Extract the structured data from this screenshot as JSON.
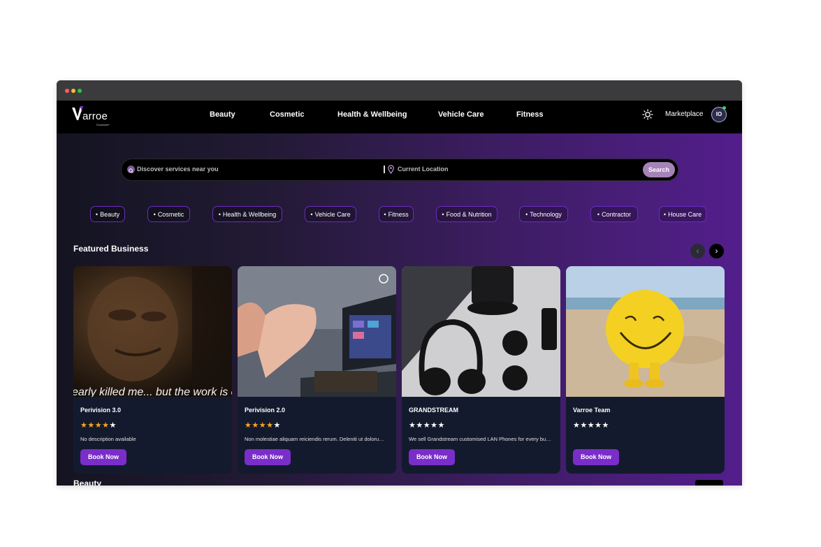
{
  "brand": {
    "name": "arroe",
    "tagline": "\"Customer\"",
    "logo_icon": "varroe-v-logo"
  },
  "nav": {
    "links": [
      "Beauty",
      "Cosmetic",
      "Health & Wellbeing",
      "Vehicle Care",
      "Fitness"
    ],
    "theme_icon": "sun-icon",
    "marketplace_label": "Marketplace",
    "avatar_initials": "IO"
  },
  "search": {
    "service_placeholder": "Discover services near you",
    "location_placeholder": "Current Location",
    "button_label": "Search"
  },
  "categories": [
    "Beauty",
    "Cosmetic",
    "Health & Wellbeing",
    "Vehicle Care",
    "Fitness",
    "Food & Nutrition",
    "Technology",
    "Contractor",
    "House Care"
  ],
  "featured": {
    "title": "Featured Business",
    "prev_icon": "chevron-left-icon",
    "next_icon": "chevron-right-icon",
    "cards": [
      {
        "name": "Perivision 3.0",
        "rating": 4,
        "description": "No description available",
        "button": "Book Now",
        "image_caption": "early killed me... but the work is c"
      },
      {
        "name": "Perivision 2.0",
        "rating": 4,
        "description": "Non molestiae aliquam reiciendis rerum. Deleniti ut dolorum e...",
        "button": "Book Now"
      },
      {
        "name": "GRANDSTREAM",
        "rating": 0,
        "description": "We sell Grandstream customised LAN Phones for every busi...",
        "button": "Book Now"
      },
      {
        "name": "Varroe Team",
        "rating": 0,
        "description": "",
        "button": "Book Now"
      }
    ]
  },
  "next_section": {
    "title": "Beauty"
  },
  "colors": {
    "accent": "#7a2ec9",
    "chip_border": "#6a2cc0",
    "star": "#f6a623",
    "search_button": "#a583b8"
  }
}
